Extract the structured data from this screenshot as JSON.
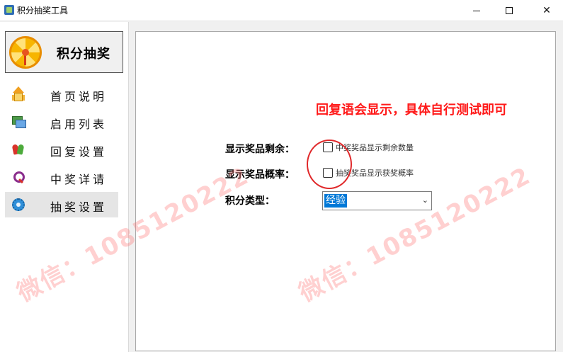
{
  "window": {
    "title": "积分抽奖工具",
    "controls": {
      "minimize": "—",
      "maximize": "☐",
      "close": "✕"
    }
  },
  "sidebar": {
    "brand": {
      "label": "积分抽奖",
      "icon": "prize-wheel-icon"
    },
    "items": [
      {
        "label": "首页说明",
        "icon": "home-icon"
      },
      {
        "label": "启用列表",
        "icon": "list-icon"
      },
      {
        "label": "回复设置",
        "icon": "reply-icon"
      },
      {
        "label": "中奖详请",
        "icon": "search-detail-icon"
      },
      {
        "label": "抽奖设置",
        "icon": "gear-icon",
        "active": true
      }
    ]
  },
  "settings": {
    "notice": "回复语会显示，具体自行测试即可",
    "show_remaining": {
      "label": "显示奖品剩余：",
      "checkbox_text": "中奖奖品显示剩余数量",
      "checked": false
    },
    "show_probability": {
      "label": "显示奖品概率：",
      "checkbox_text": "抽奖奖品显示获奖概率",
      "checked": false
    },
    "points_type": {
      "label": "积分类型：",
      "selected": "经验"
    }
  },
  "watermarks": {
    "left": "微信：1085120222",
    "right": "微信：1085120222"
  },
  "colors": {
    "notice": "#ff1a1a",
    "selection": "#0078d7",
    "annotation_circle": "#e0282a"
  }
}
